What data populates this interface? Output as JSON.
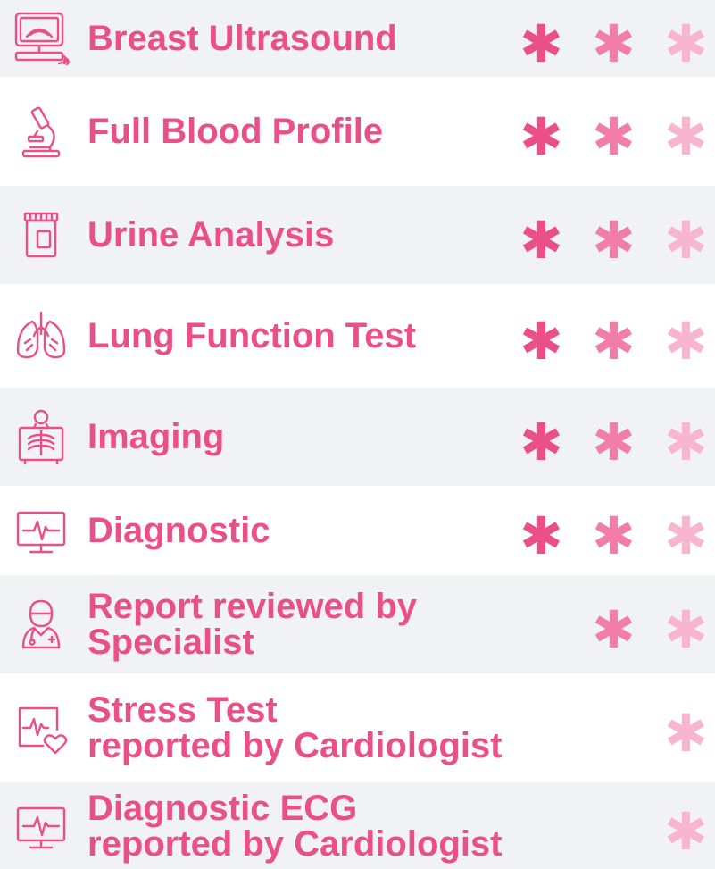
{
  "colors": {
    "accent": "#ea4f88",
    "star_1": "#ea4f88",
    "star_2": "#f27da8",
    "star_3": "#f7b6cd",
    "row_shade": "#f1f2f4",
    "row_plain": "#ffffff"
  },
  "star_glyph": "✱",
  "rows": [
    {
      "icon": "ultrasound-machine-icon",
      "line1": "Breast Ultrasound",
      "line2": "",
      "stars": [
        true,
        true,
        true
      ]
    },
    {
      "icon": "microscope-icon",
      "line1": "Full Blood Profile",
      "line2": "",
      "stars": [
        true,
        true,
        true
      ]
    },
    {
      "icon": "urine-sample-cup-icon",
      "line1": "Urine Analysis",
      "line2": "",
      "stars": [
        true,
        true,
        true
      ]
    },
    {
      "icon": "lungs-icon",
      "line1": "Lung Function Test",
      "line2": "",
      "stars": [
        true,
        true,
        true
      ]
    },
    {
      "icon": "x-ray-person-icon",
      "line1": "Imaging",
      "line2": "",
      "stars": [
        true,
        true,
        true
      ]
    },
    {
      "icon": "ecg-monitor-icon",
      "line1": "Diagnostic",
      "line2": "",
      "stars": [
        true,
        true,
        true
      ]
    },
    {
      "icon": "doctor-icon",
      "line1": "Report reviewed by",
      "line2": "Specialist",
      "stars": [
        false,
        true,
        true
      ]
    },
    {
      "icon": "heart-monitor-icon",
      "line1": "Stress Test",
      "line2": "reported by Cardiologist",
      "stars": [
        false,
        false,
        true
      ]
    },
    {
      "icon": "ecg-monitor-icon",
      "line1": "Diagnostic ECG",
      "line2": "reported by Cardiologist",
      "stars": [
        false,
        false,
        true
      ]
    }
  ]
}
